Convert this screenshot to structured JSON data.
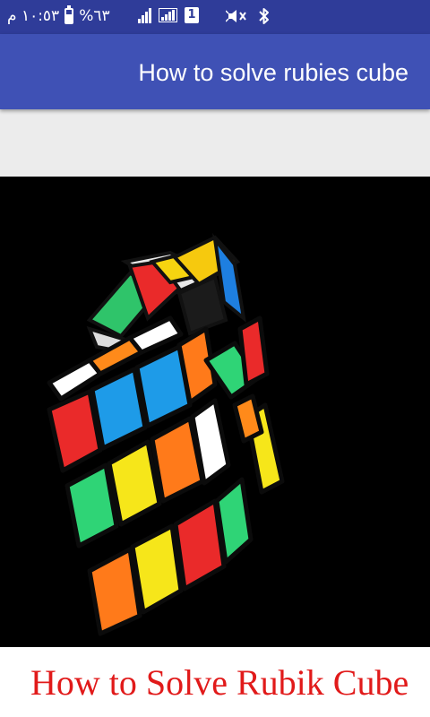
{
  "status_bar": {
    "time": "١٠:٥٣ م",
    "battery_percent": "%٦٣",
    "sim_slot": "1",
    "battery_level": 0.63,
    "icons": [
      "signal-icon",
      "signal-icon",
      "sim-icon",
      "mute-icon",
      "bluetooth-icon"
    ]
  },
  "app_bar": {
    "title": "How to solve rubies cube",
    "color": "#3f51b5"
  },
  "hero_image": {
    "description_icon": "rubiks-cube-image",
    "caption": "How to Solve Rubik Cube",
    "caption_color": "#e11a1a"
  }
}
